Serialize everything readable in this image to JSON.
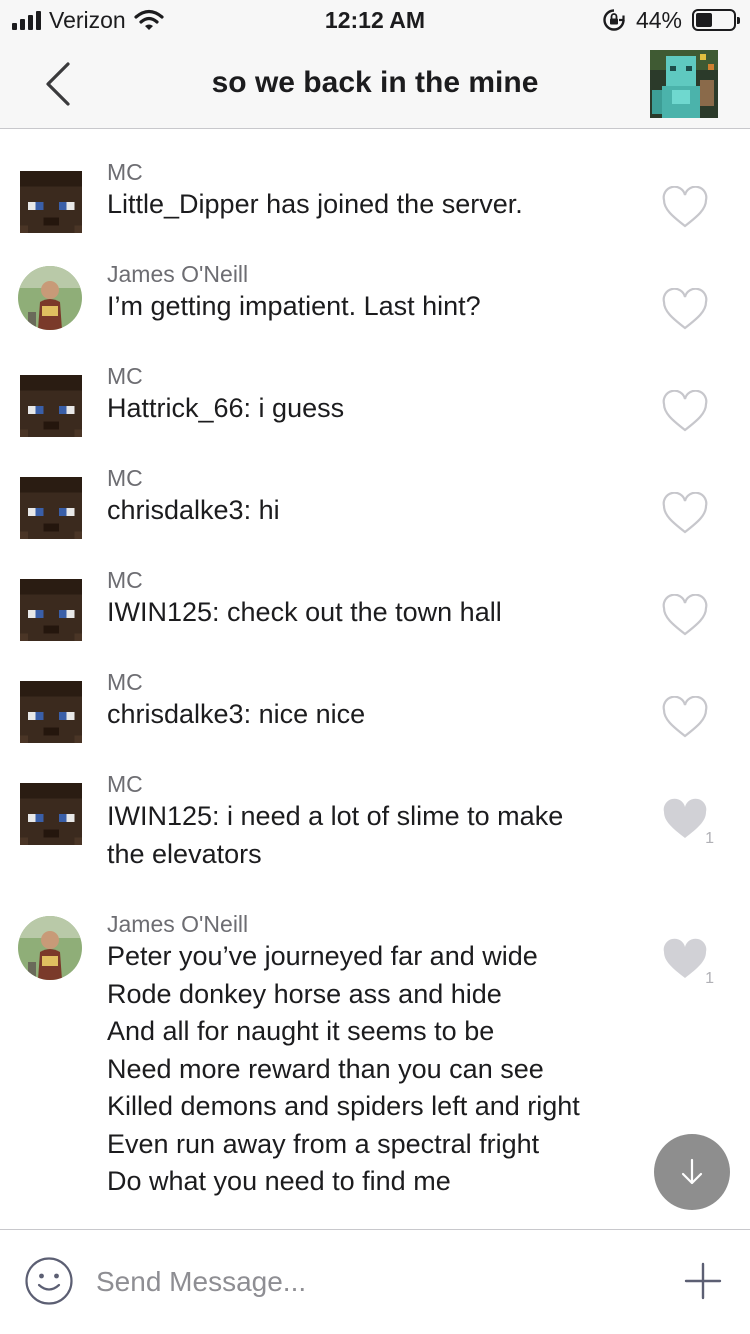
{
  "status_bar": {
    "carrier": "Verizon",
    "time": "12:12 AM",
    "battery": "44%",
    "battery_level": 0.44,
    "icons": [
      "signal-icon",
      "wifi-icon",
      "rotation-lock-icon",
      "battery-icon"
    ]
  },
  "header": {
    "title": "so we back in the mine",
    "back_icon": "chevron-left-icon",
    "group_avatar": "minecraft-character-avatar"
  },
  "messages": [
    {
      "sender": "MC",
      "text": "Little_Dipper has joined the server.",
      "liked": false,
      "likes": ""
    },
    {
      "sender": "James O'Neill",
      "text": "I’m getting impatient. Last hint?",
      "liked": false,
      "likes": ""
    },
    {
      "sender": "MC",
      "text": "Hattrick_66: i guess",
      "liked": false,
      "likes": ""
    },
    {
      "sender": "MC",
      "text": "chrisdalke3: hi",
      "liked": false,
      "likes": ""
    },
    {
      "sender": "MC",
      "text": "IWIN125: check out the town hall",
      "liked": false,
      "likes": ""
    },
    {
      "sender": "MC",
      "text": "chrisdalke3: nice nice",
      "liked": false,
      "likes": ""
    },
    {
      "sender": "MC",
      "text": "IWIN125: i need a lot of slime to make\nthe elevators",
      "liked": true,
      "likes": "1"
    },
    {
      "sender": "James O'Neill",
      "text": "Peter you’ve journeyed far and wide\nRode donkey horse ass and hide\nAnd all for naught it seems to be\nNeed more reward than you can see\nKilled demons and spiders left and right\nEven run away from a spectral fright\nDo what you need to find me",
      "liked": true,
      "likes": "1"
    }
  ],
  "composer": {
    "placeholder": "Send Message...",
    "emoji_icon": "smiley-icon",
    "add_icon": "plus-icon"
  },
  "scroll_button_icon": "arrow-down-icon",
  "colors": {
    "bar_background": "#f7f7f7",
    "heart_outline": "#c7c7cc",
    "heart_filled": "#d1d1d6",
    "fab": "#8e8e8e",
    "secondary_text": "#6d6d72"
  }
}
